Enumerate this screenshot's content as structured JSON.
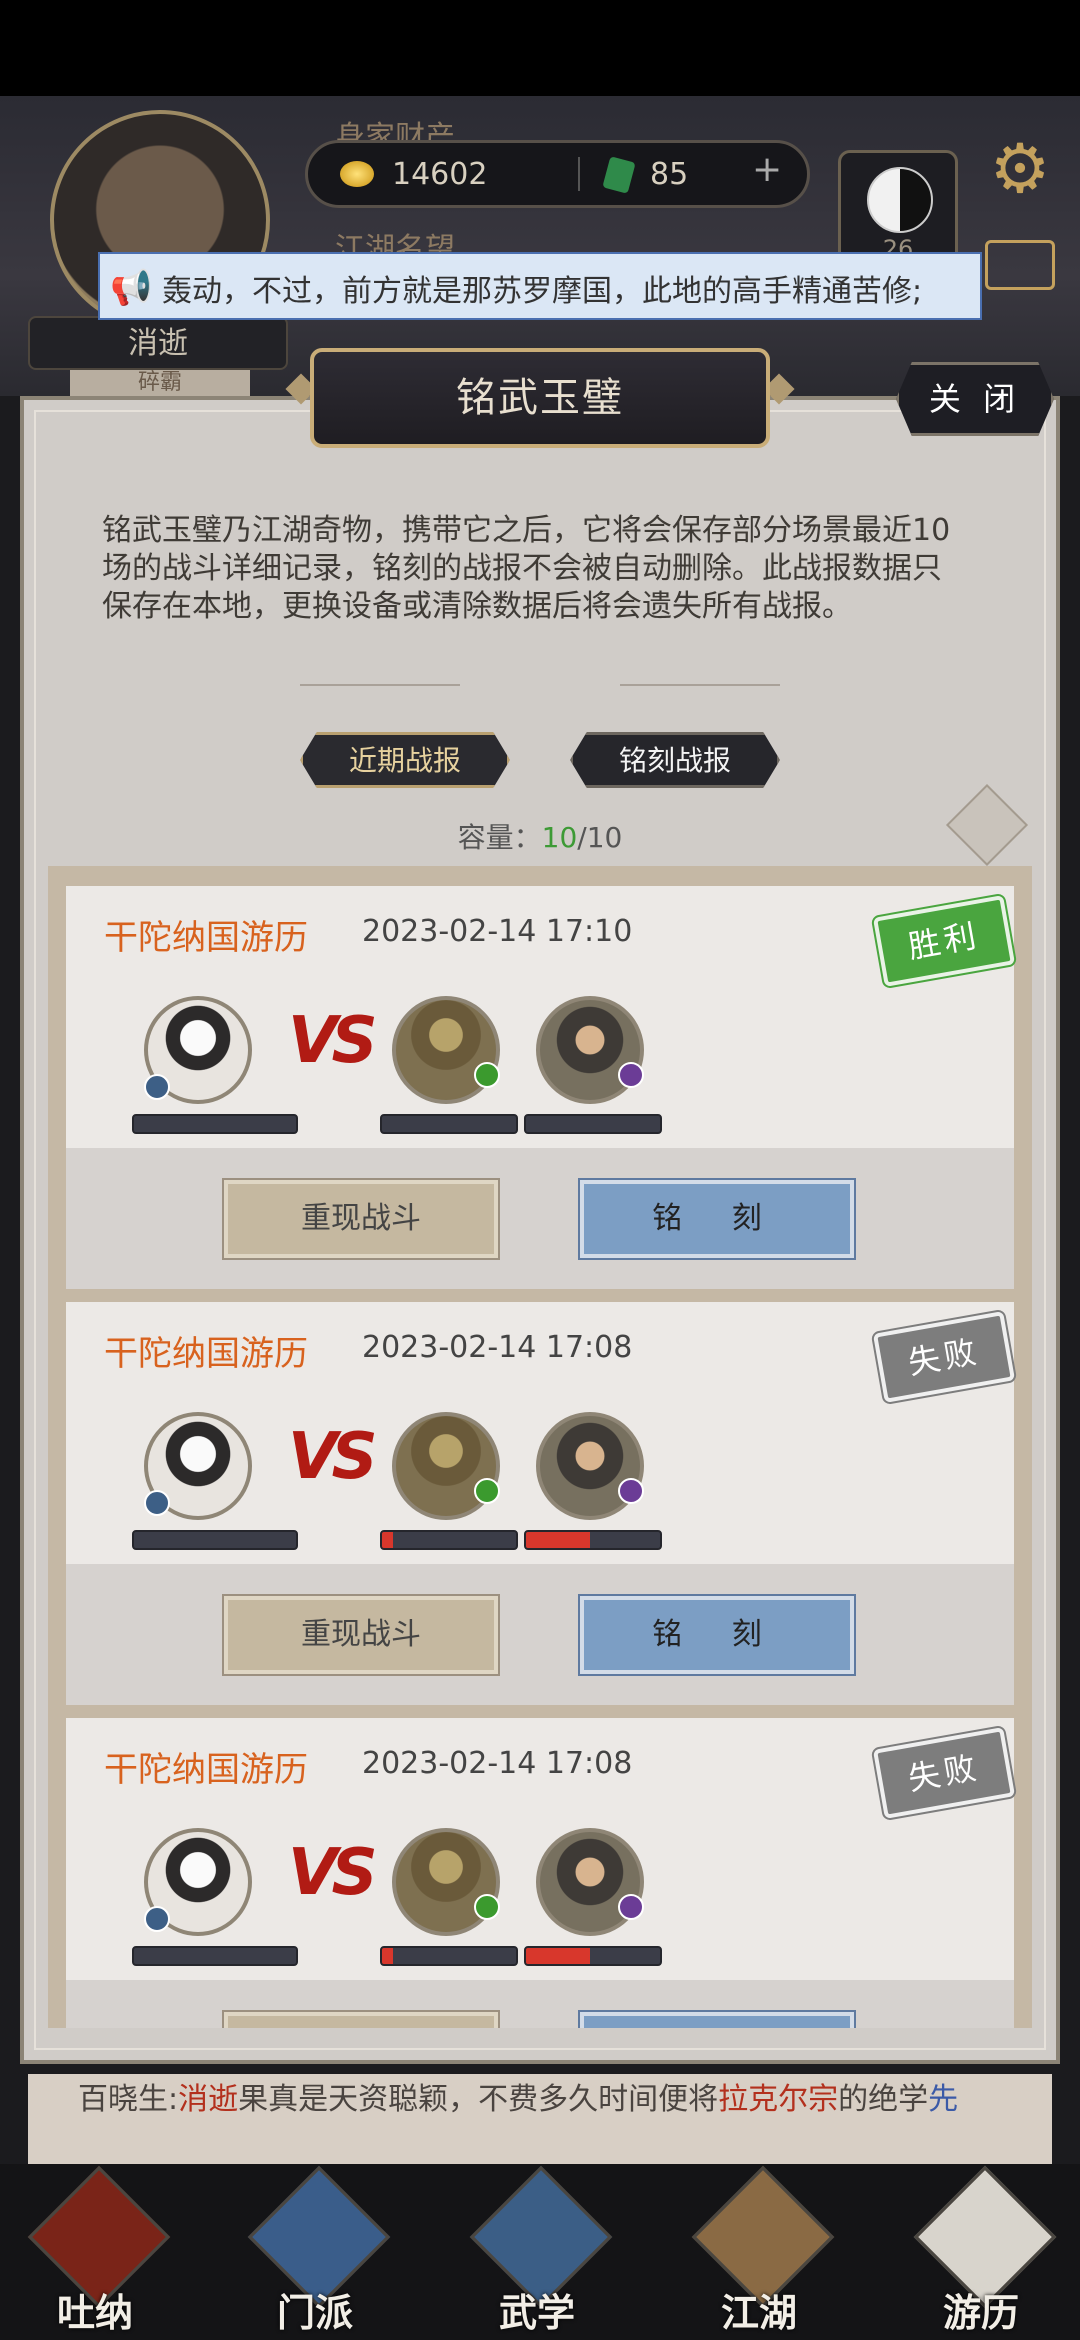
{
  "header": {
    "wealth_label": "身家财产",
    "gold": "14602",
    "jade": "85",
    "fame_label": "江湖名望",
    "taiji_level": "26",
    "player_name": "消逝",
    "broken_label": "碎霸"
  },
  "marquee": {
    "text": "轰动，不过，前方就是那苏罗摩国，此地的高手精通苦修;"
  },
  "dialog": {
    "title": "铭武玉璧",
    "close_label": "关 闭",
    "description": "铭武玉璧乃江湖奇物，携带它之后，它将会保存部分场景最近10场的战斗详细记录，铭刻的战报不会被自动删除。此战报数据只保存在本地，更换设备或清除数据后将会遗失所有战报。",
    "tabs": [
      "近期战报",
      "铭刻战报"
    ],
    "capacity_label": "容量：",
    "capacity_used": "10",
    "capacity_total": "/10"
  },
  "battles": [
    {
      "title": "干陀纳国游历",
      "time": "2023-02-14 17:10",
      "result": "胜利",
      "result_type": "win",
      "enemy_hp": [
        0,
        0
      ],
      "vs": "VS",
      "replay_label": "重现战斗",
      "engrave_label": "铭 刻"
    },
    {
      "title": "干陀纳国游历",
      "time": "2023-02-14 17:08",
      "result": "失败",
      "result_type": "lose",
      "enemy_hp": [
        0.08,
        0.48
      ],
      "vs": "VS",
      "replay_label": "重现战斗",
      "engrave_label": "铭 刻"
    },
    {
      "title": "干陀纳国游历",
      "time": "2023-02-14 17:08",
      "result": "失败",
      "result_type": "lose",
      "enemy_hp": [
        0.08,
        0.48
      ],
      "vs": "VS"
    }
  ],
  "log": {
    "speaker": "百晓生:",
    "name1": "消逝",
    "text1": "果真是天资聪颖，不费多久时间便将",
    "name2": "拉克尔宗",
    "text2": "的绝学",
    "tail": "先"
  },
  "nav": {
    "items": [
      "吐纳",
      "门派",
      "武学",
      "江湖",
      "游历"
    ]
  },
  "colors": {
    "accent_orange": "#d8621e",
    "win_green": "#4aa53f",
    "lose_gray": "#7d7d7d",
    "engrave_blue": "#7c9ec4",
    "hp_red": "#d8372c"
  }
}
